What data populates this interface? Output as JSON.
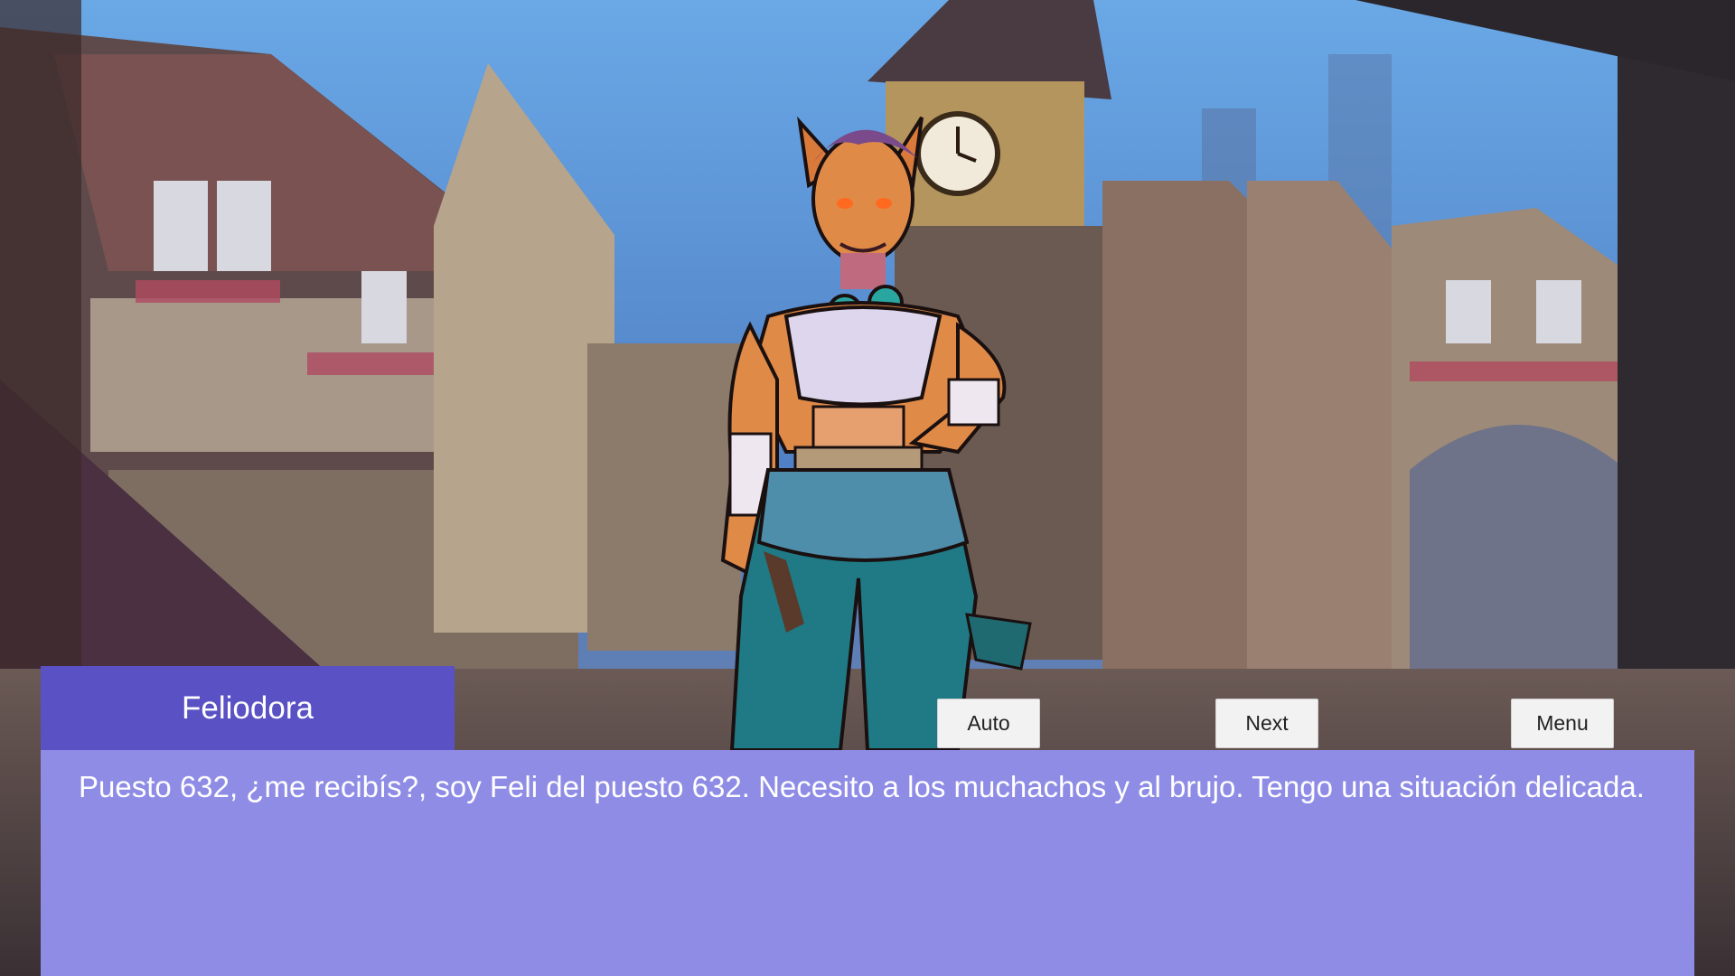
{
  "scene": {
    "background_icon": "medieval-town-background",
    "character_icon": "feliodora-character-sprite"
  },
  "dialogue": {
    "speaker": "Feliodora",
    "text": "Puesto 632, ¿me recibís?, soy Feli del puesto 632. Necesito a los muchachos y al brujo. Tengo una situación delicada."
  },
  "controls": {
    "auto_label": "Auto",
    "next_label": "Next",
    "menu_label": "Menu"
  },
  "colors": {
    "name_box": "#5a52c4",
    "dialogue_box": "#8f8ce6",
    "button": "#f2f2f2"
  }
}
